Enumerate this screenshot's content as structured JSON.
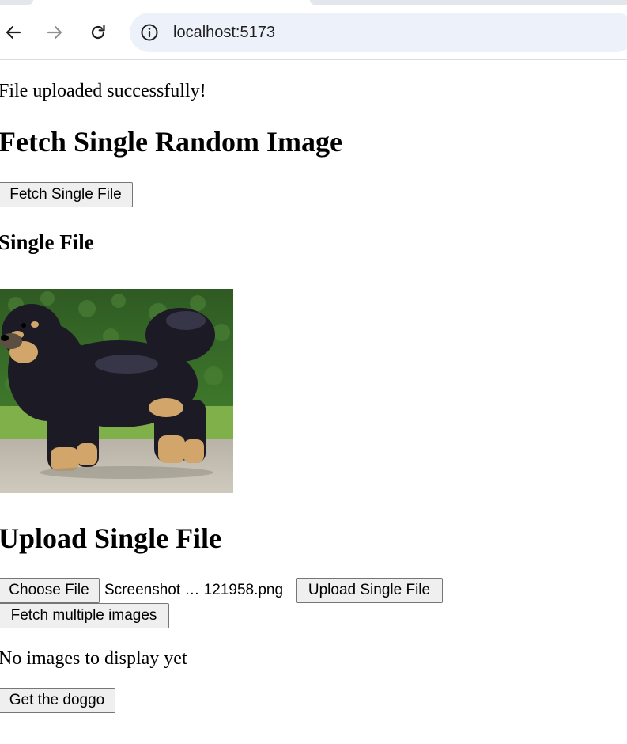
{
  "browser": {
    "url": "localhost:5173",
    "back_icon": "arrow-left-icon",
    "forward_icon": "arrow-right-icon",
    "reload_icon": "reload-icon",
    "site_info_icon": "info-icon"
  },
  "page": {
    "status_message": "File uploaded successfully!",
    "fetch_section": {
      "heading": "Fetch Single Random Image",
      "fetch_button_label": "Fetch Single File"
    },
    "single_file_section": {
      "heading": "Single File",
      "image_subject": "Tibetan Mastiff dog standing on pavement"
    },
    "upload_section": {
      "heading": "Upload Single File",
      "choose_file_label": "Choose File",
      "chosen_file_name": "Screenshot … 121958.png",
      "upload_button_label": "Upload Single File"
    },
    "multiple_section": {
      "fetch_multiple_label": "Fetch multiple images",
      "empty_message": "No images to display yet"
    },
    "doggo_button_label": "Get the doggo"
  },
  "colors": {
    "omnibox_background": "#edf2fa",
    "button_background": "#efefef",
    "button_border": "#767676"
  }
}
